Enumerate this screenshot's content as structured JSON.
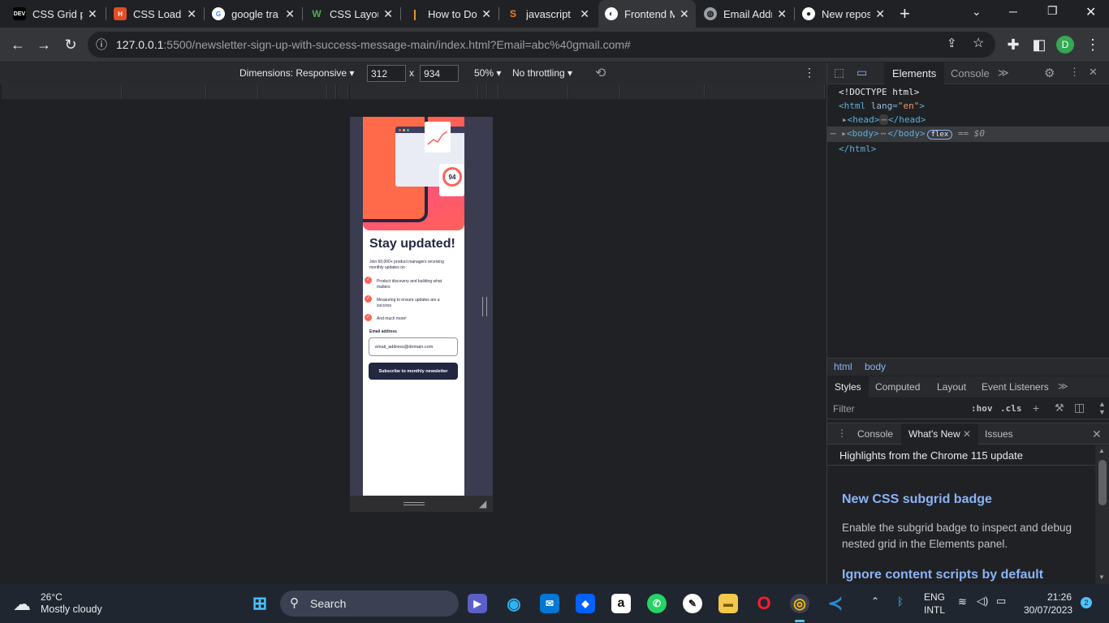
{
  "browser": {
    "tabs": [
      {
        "title": "CSS Grid p",
        "favicon_text": "DEV",
        "favicon_color": "#000000"
      },
      {
        "title": "CSS Loadin",
        "favicon_text": "H",
        "favicon_color": "#e44d26"
      },
      {
        "title": "google tra",
        "favicon_text": "G",
        "favicon_color": "#ffffff"
      },
      {
        "title": "CSS Layou",
        "favicon_text": "W",
        "favicon_color": "#0a2a0a"
      },
      {
        "title": "How to Do",
        "favicon_text": "|",
        "favicon_color": "#f0a030"
      },
      {
        "title": "javascript",
        "favicon_text": "S",
        "favicon_color": "#f48024"
      },
      {
        "title": "Frontend M",
        "favicon_text": "◐",
        "favicon_color": "#ffffff"
      },
      {
        "title": "Email Addr",
        "favicon_text": "◍",
        "favicon_color": "#9aa0a6"
      },
      {
        "title": "New repos",
        "favicon_text": "●",
        "favicon_color": "#ffffff"
      }
    ],
    "new_tab": "+",
    "url_host": "127.0.0.1",
    "url_rest": ":5500/newsletter-sign-up-with-success-message-main/index.html?Email=abc%40gmail.com#",
    "profile_initial": "D"
  },
  "device_toolbar": {
    "dimensions_label": "Dimensions: Responsive",
    "width": "312",
    "height": "934",
    "times": "x",
    "zoom": "50%",
    "throttling": "No throttling"
  },
  "page": {
    "hero_score": "94",
    "title": "Stay updated!",
    "intro": "Join 60,000+ product managers receiving monthly updates on :",
    "features": [
      "Product discovery and building what matters",
      "Measuring to ensure updates are a success",
      "And much more!"
    ],
    "email_label": "Email address",
    "email_placeholder": "email_address@domain.com",
    "subscribe_label": "Subscribe to monthly newsletter"
  },
  "devtools": {
    "tabs": {
      "elements": "Elements",
      "console": "Console"
    },
    "dom": {
      "doctype": "<!DOCTYPE html>",
      "html_open_tag": "html",
      "html_attr": "lang",
      "html_attr_value": "\"en\"",
      "head": "head",
      "body": "body",
      "ellipsis": "⋯",
      "flex_badge": "flex",
      "selected_marker": "== $0",
      "html_close": "</html>"
    },
    "breadcrumbs": [
      "html",
      "body"
    ],
    "styles_tabs": [
      "Styles",
      "Computed",
      "Layout",
      "Event Listeners"
    ],
    "filter_placeholder": "Filter",
    "hov": ":hov",
    "cls": ".cls",
    "drawer_tabs": [
      "Console",
      "What's New",
      "Issues"
    ],
    "whatsnew": {
      "header": "Highlights from the Chrome 115 update",
      "item1_title": "New CSS subgrid badge",
      "item1_body": "Enable the subgrid badge to inspect and debug nested grid in the Elements panel.",
      "item2_title": "Ignore content scripts by default"
    }
  },
  "taskbar": {
    "weather_temp": "26°C",
    "weather_desc": "Mostly cloudy",
    "search_label": "Search",
    "lang_top": "ENG",
    "lang_bottom": "INTL",
    "time": "21:26",
    "date": "30/07/2023",
    "notifications": "2"
  }
}
